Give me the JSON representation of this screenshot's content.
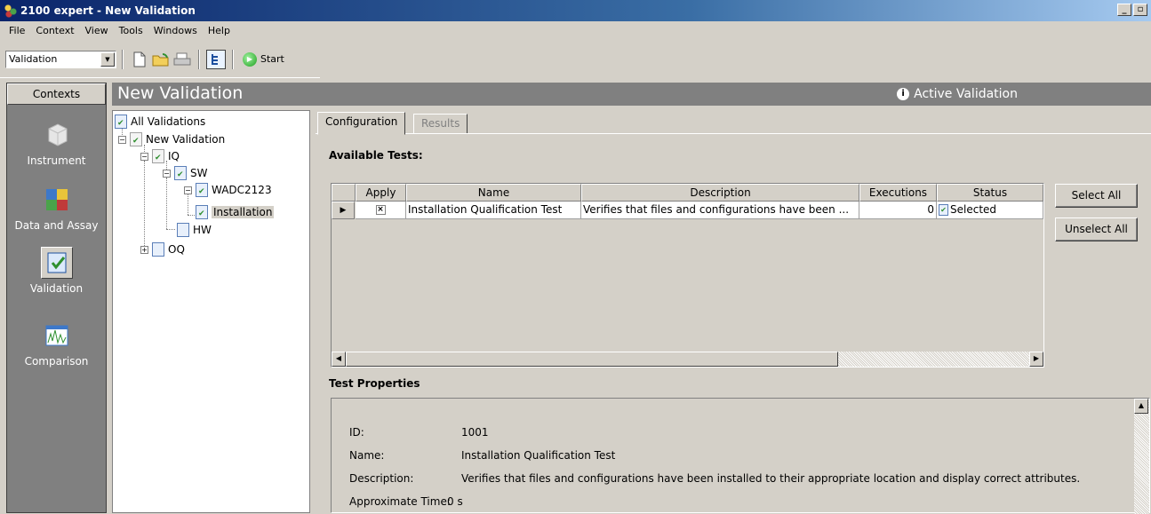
{
  "window": {
    "title": "2100 expert - New Validation",
    "min_label": "_",
    "restore_label": "▫"
  },
  "menubar": {
    "items": [
      "File",
      "Context",
      "View",
      "Tools",
      "Windows",
      "Help"
    ]
  },
  "toolbar": {
    "context_select": "Validation",
    "start_label": "Start",
    "icons": [
      "new-icon",
      "open-icon",
      "print-icon",
      "tree-view-icon",
      "start-icon"
    ]
  },
  "contexts": {
    "header": "Contexts",
    "items": [
      {
        "label": "Instrument",
        "icon": "instrument-icon"
      },
      {
        "label": "Data and Assay",
        "icon": "data-assay-icon"
      },
      {
        "label": "Validation",
        "icon": "validation-icon",
        "selected": true
      },
      {
        "label": "Comparison",
        "icon": "comparison-icon"
      }
    ]
  },
  "header": {
    "title": "New Validation",
    "status": "Active Validation"
  },
  "tree": {
    "root": "All Validations",
    "nodes": [
      "New Validation",
      "IQ",
      "SW",
      "WADC2123",
      "Installation",
      "HW",
      "OQ"
    ]
  },
  "tabs": [
    {
      "label": "Configuration",
      "active": true
    },
    {
      "label": "Results",
      "active": false
    }
  ],
  "available_tests": {
    "heading": "Available Tests:",
    "columns": [
      "Apply",
      "Name",
      "Description",
      "Executions",
      "Status"
    ],
    "rows": [
      {
        "apply": "×",
        "name": "Installation Qualification Test",
        "description": "Verifies that files and configurations have been ...",
        "executions": "0",
        "status": "Selected"
      }
    ],
    "select_all": "Select All",
    "unselect_all": "Unselect All"
  },
  "test_properties": {
    "heading": "Test Properties",
    "fields": [
      {
        "label": "ID:",
        "value": "1001"
      },
      {
        "label": "Name:",
        "value": "Installation Qualification Test"
      },
      {
        "label": "Description:",
        "value": "Verifies that files and configurations have been installed to their appropriate location and display correct attributes."
      },
      {
        "label": "Approximate Time:",
        "value": "0 s"
      }
    ]
  }
}
